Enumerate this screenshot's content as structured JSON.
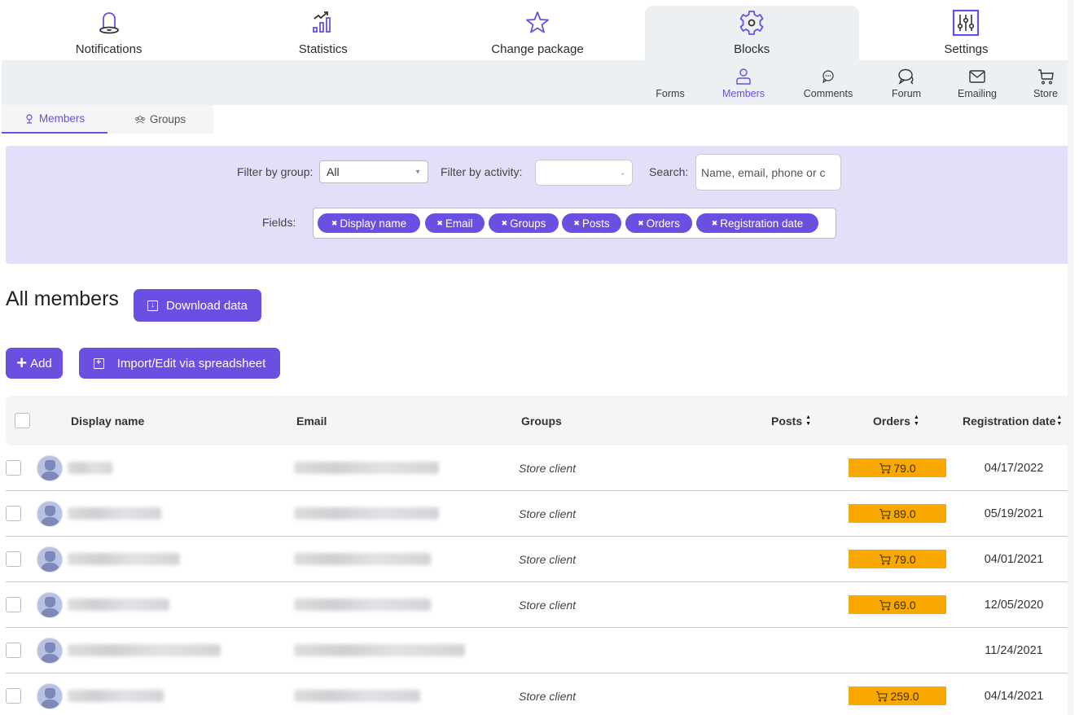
{
  "top_nav": [
    {
      "id": "notifications",
      "label": "Notifications",
      "icon": "bell-icon",
      "active": false
    },
    {
      "id": "statistics",
      "label": "Statistics",
      "icon": "chart-icon",
      "active": false
    },
    {
      "id": "change-package",
      "label": "Change package",
      "icon": "star-icon",
      "active": false
    },
    {
      "id": "blocks",
      "label": "Blocks",
      "icon": "gear-icon",
      "active": true
    },
    {
      "id": "settings",
      "label": "Settings",
      "icon": "sliders-icon",
      "active": false
    }
  ],
  "sub_nav": [
    {
      "id": "forms",
      "label": "Forms",
      "icon": "",
      "active": false
    },
    {
      "id": "members",
      "label": "Members",
      "icon": "user-icon",
      "active": true
    },
    {
      "id": "comments",
      "label": "Comments",
      "icon": "comment-icon",
      "active": false
    },
    {
      "id": "forum",
      "label": "Forum",
      "icon": "chat-bubbles-icon",
      "active": false
    },
    {
      "id": "emailing",
      "label": "Emailing",
      "icon": "envelope-icon",
      "active": false
    },
    {
      "id": "store",
      "label": "Store",
      "icon": "cart-icon",
      "active": false
    }
  ],
  "sub_tabs": [
    {
      "label": "Members",
      "icon": "member-icon",
      "active": true
    },
    {
      "label": "Groups",
      "icon": "groups-icon",
      "active": false
    }
  ],
  "filters": {
    "group_label": "Filter by group:",
    "group_value": "All",
    "activity_label": "Filter by activity:",
    "activity_value": "",
    "search_label": "Search:",
    "search_placeholder": "Name, email, phone or c",
    "fields_label": "Fields:",
    "fields": [
      "Display name",
      "Email",
      "Groups",
      "Posts",
      "Orders",
      "Registration date"
    ]
  },
  "heading": "All members",
  "buttons": {
    "download": "Download data",
    "add": "Add",
    "import": "Import/Edit via spreadsheet"
  },
  "table": {
    "columns": [
      "Display name",
      "Email",
      "Groups",
      "Posts",
      "Orders",
      "Registration date"
    ],
    "rows": [
      {
        "name": "[blurred]",
        "email": "[blurred]",
        "group": "Store client",
        "posts": "",
        "orders": "79.0",
        "date": "04/17/2022"
      },
      {
        "name": "[blurred]",
        "email": "[blurred]",
        "group": "Store client",
        "posts": "",
        "orders": "89.0",
        "date": "05/19/2021"
      },
      {
        "name": "[blurred]",
        "email": "[blurred]",
        "group": "Store client",
        "posts": "",
        "orders": "79.0",
        "date": "04/01/2021"
      },
      {
        "name": "[blurred]",
        "email": "[blurred]",
        "group": "Store client",
        "posts": "",
        "orders": "69.0",
        "date": "12/05/2020"
      },
      {
        "name": "[blurred]",
        "email": "[blurred]",
        "group": "",
        "posts": "",
        "orders": "",
        "date": "11/24/2021"
      },
      {
        "name": "[blurred]",
        "email": "[blurred]",
        "group": "Store client",
        "posts": "",
        "orders": "259.0",
        "date": "04/14/2021"
      }
    ]
  },
  "colors": {
    "accent": "#6b4fe0",
    "filter_bg": "#e3dff8",
    "order_badge": "#f8a800",
    "nav_bg": "#ecf0f3"
  }
}
